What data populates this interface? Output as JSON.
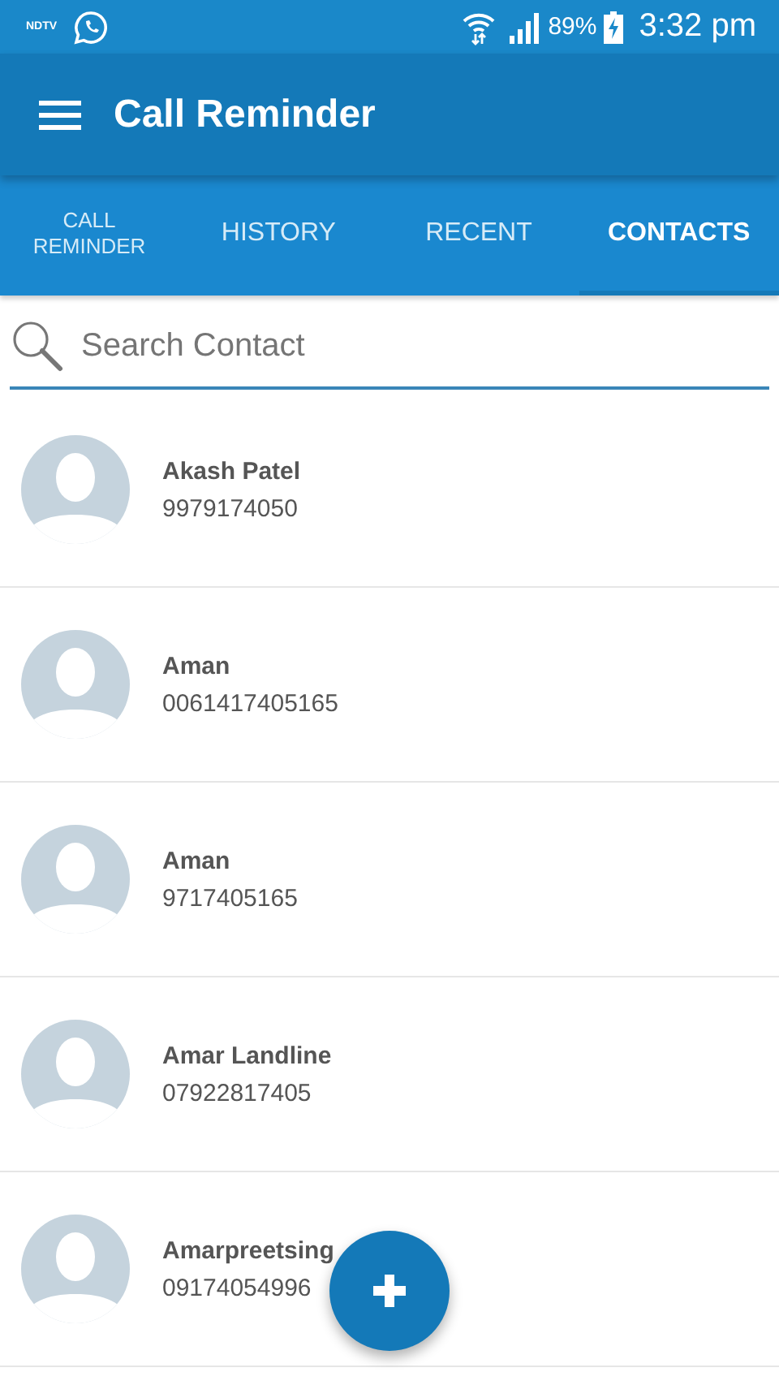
{
  "status_bar": {
    "notification_label": "NDTV",
    "battery": "89%",
    "time": "3:32 pm"
  },
  "toolbar": {
    "title": "Call Reminder"
  },
  "tabs": [
    {
      "label": "CALL REMINDER",
      "selected": false
    },
    {
      "label": "HISTORY",
      "selected": false
    },
    {
      "label": "RECENT",
      "selected": false
    },
    {
      "label": "CONTACTS",
      "selected": true
    }
  ],
  "search": {
    "placeholder": "Search Contact"
  },
  "contacts": [
    {
      "name": "Akash Patel",
      "phone": "9979174050"
    },
    {
      "name": "Aman",
      "phone": "0061417405165"
    },
    {
      "name": "Aman",
      "phone": "9717405165"
    },
    {
      "name": "Amar Landline",
      "phone": "07922817405"
    },
    {
      "name": "Amarpreetsing",
      "phone": "09174054996"
    }
  ]
}
